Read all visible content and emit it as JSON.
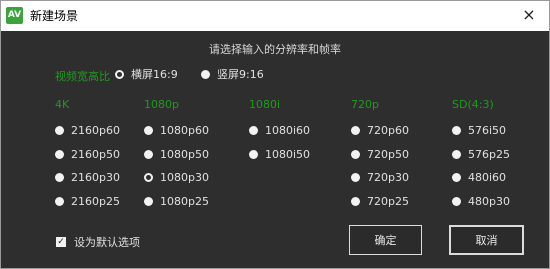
{
  "window": {
    "title": "新建场景",
    "close_icon": "×",
    "app_icon_text": "AV"
  },
  "heading": "请选择输入的分辨率和帧率",
  "aspect": {
    "label": "视频宽高比",
    "options": [
      {
        "label": "横屏16:9",
        "checked": true
      },
      {
        "label": "竖屏9:16",
        "checked": false
      }
    ]
  },
  "groups": [
    {
      "label": "4K",
      "options": [
        "2160p60",
        "2160p50",
        "2160p30",
        "2160p25"
      ]
    },
    {
      "label": "1080p",
      "options": [
        "1080p60",
        "1080p50",
        "1080p30",
        "1080p25"
      ]
    },
    {
      "label": "1080i",
      "options": [
        "1080i60",
        "1080i50"
      ]
    },
    {
      "label": "720p",
      "options": [
        "720p60",
        "720p50",
        "720p30",
        "720p25"
      ]
    },
    {
      "label": "SD(4:3)",
      "options": [
        "576i50",
        "576p25",
        "480i60",
        "480p30"
      ]
    }
  ],
  "selected_resolution": "1080p30",
  "default_checkbox": {
    "label": "设为默认选项",
    "checked": true
  },
  "buttons": {
    "ok": "确定",
    "cancel": "取消"
  },
  "colors": {
    "accent_green": "#1f9a1f",
    "background": "#2e2e2e"
  }
}
